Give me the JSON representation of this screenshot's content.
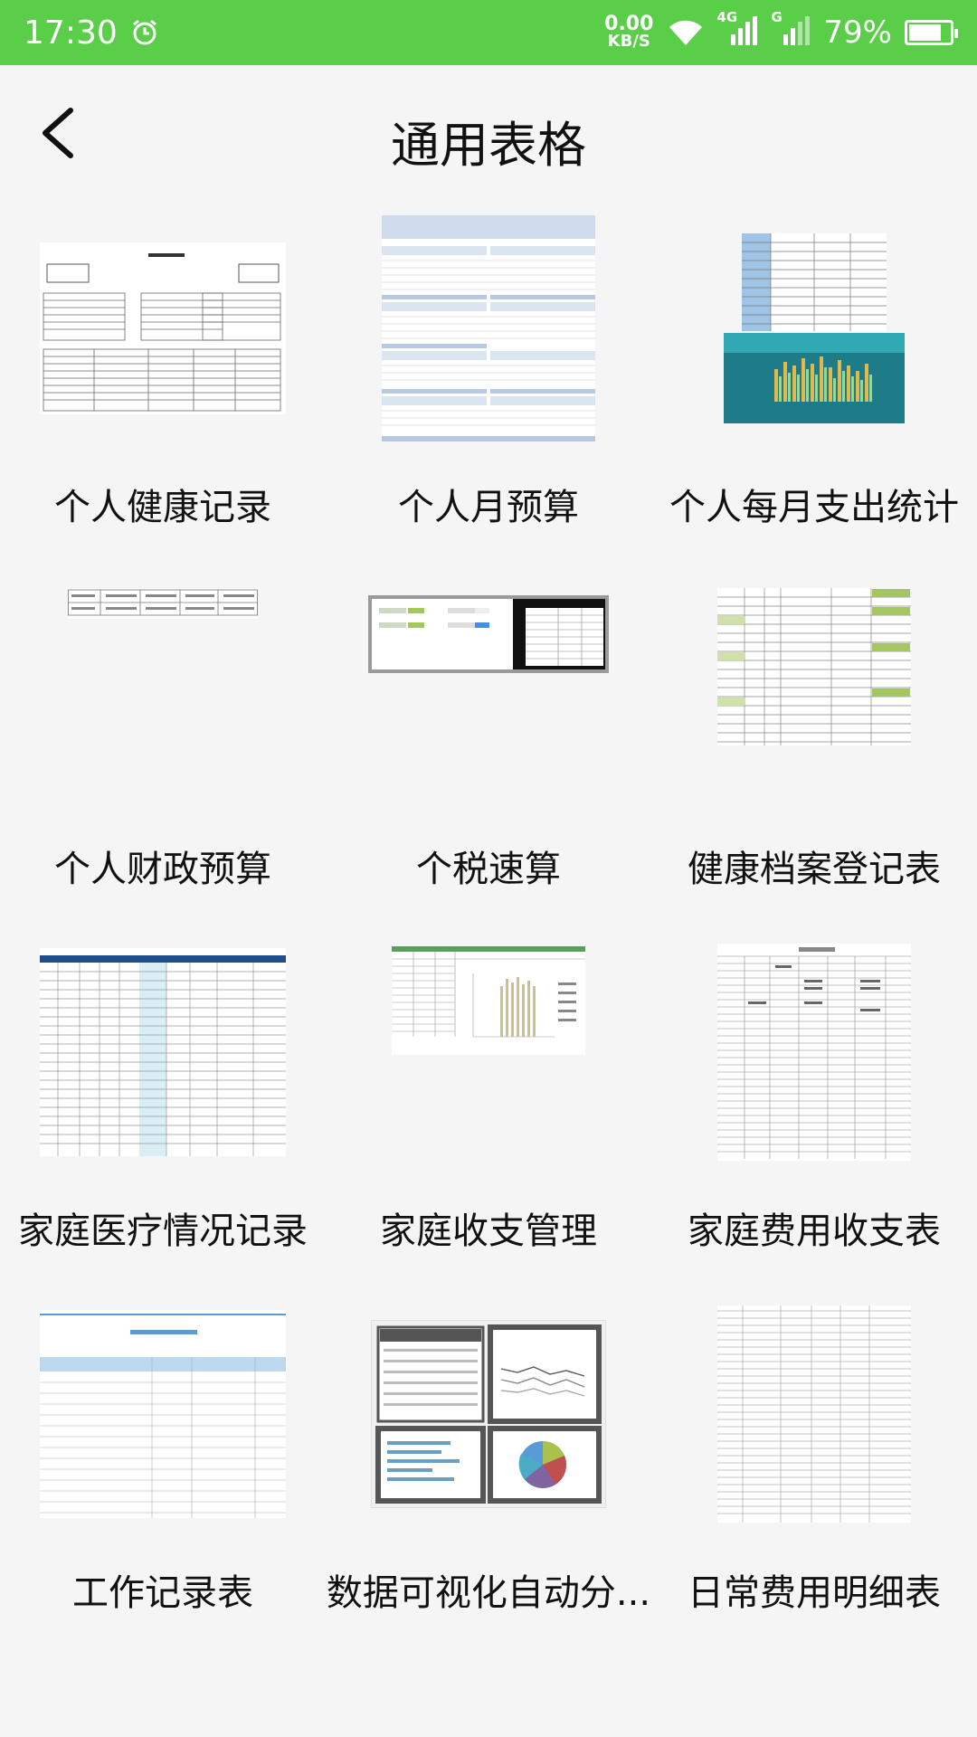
{
  "status_bar": {
    "time": "17:30",
    "net_speed_value": "0.00",
    "net_speed_unit": "KB/S",
    "signal1_label": "4G",
    "signal2_label": "G",
    "battery": "79%",
    "battery_level": 0.79,
    "bg_color": "#5ace48"
  },
  "header": {
    "back_icon": "chevron-left-icon",
    "title": "通用表格"
  },
  "templates": [
    {
      "label": "个人健康记录"
    },
    {
      "label": "个人月预算"
    },
    {
      "label": "个人每月支出统计"
    },
    {
      "label": "个人财政预算"
    },
    {
      "label": "个税速算"
    },
    {
      "label": "健康档案登记表"
    },
    {
      "label": "家庭医疗情况记录"
    },
    {
      "label": "家庭收支管理"
    },
    {
      "label": "家庭费用收支表"
    },
    {
      "label": "工作记录表"
    },
    {
      "label": "数据可视化自动分..."
    },
    {
      "label": "日常费用明细表"
    }
  ]
}
